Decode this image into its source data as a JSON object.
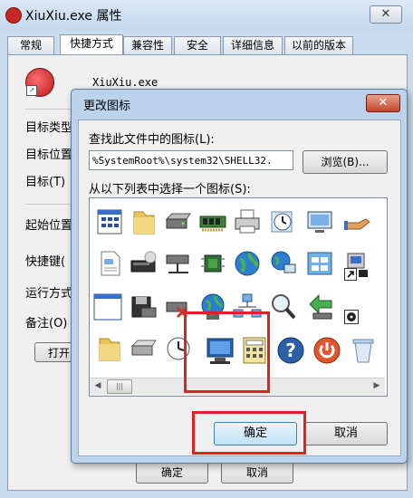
{
  "properties_window": {
    "title": "XiuXiu.exe 属性",
    "close_label": "✕",
    "tabs": [
      {
        "label": "常规"
      },
      {
        "label": "快捷方式"
      },
      {
        "label": "兼容性"
      },
      {
        "label": "安全"
      },
      {
        "label": "详细信息"
      },
      {
        "label": "以前的版本"
      }
    ],
    "active_tab": "快捷方式",
    "file_name": "XiuXiu.exe",
    "field_labels": {
      "target_type": "目标类型",
      "target_location": "目标位置",
      "target": "目标(T)",
      "start_in": "起始位置",
      "shortcut_key": "快捷键(",
      "run": "运行方式",
      "comment": "备注(O)"
    },
    "open_button": "打开",
    "ok_button": "确定",
    "cancel_button": "取消"
  },
  "change_icon_dialog": {
    "title": "更改图标",
    "close_label": "✕",
    "search_label": "查找此文件中的图标(L):",
    "path_value": "%SystemRoot%\\system32\\SHELL32.",
    "browse_button": "浏览(B)...",
    "select_label": "从以下列表中选择一个图标(S):",
    "ok_button": "确定",
    "cancel_button": "取消",
    "icons": [
      {
        "name": "window-list-icon"
      },
      {
        "name": "folder-icon"
      },
      {
        "name": "drive-icon"
      },
      {
        "name": "memory-chip-icon"
      },
      {
        "name": "printer-icon"
      },
      {
        "name": "clock-icon"
      },
      {
        "name": "display-icon"
      },
      {
        "name": "hand-share-icon"
      },
      {
        "name": "document-icon"
      },
      {
        "name": "cd-drive-icon"
      },
      {
        "name": "network-drive-icon"
      },
      {
        "name": "chip-icon"
      },
      {
        "name": "globe-icon"
      },
      {
        "name": "network-globe-icon"
      },
      {
        "name": "control-panel-icon"
      },
      {
        "name": "phone-icon"
      },
      {
        "name": "shortcut-arrow-icon"
      },
      {
        "name": "blank-window-icon"
      },
      {
        "name": "floppy-icon"
      },
      {
        "name": "delete-drive-icon"
      },
      {
        "name": "globe-pc-icon"
      },
      {
        "name": "network-tree-icon"
      },
      {
        "name": "magnifier-icon"
      },
      {
        "name": "green-arrow-icon"
      },
      {
        "name": "small-disc-icon"
      },
      {
        "name": "folder-icon"
      },
      {
        "name": "drive-icon"
      },
      {
        "name": "clock-globe-icon"
      },
      {
        "name": "computer-icon"
      },
      {
        "name": "calculator-icon"
      },
      {
        "name": "help-icon"
      },
      {
        "name": "power-icon"
      },
      {
        "name": "recycle-bin-icon"
      }
    ],
    "selected_icon": "computer-icon",
    "scroll_thumb": "|||"
  },
  "colors": {
    "annotation_red": "#e12222",
    "dialog_frame": "#bcd3ec",
    "close_red": "#c4452c"
  }
}
